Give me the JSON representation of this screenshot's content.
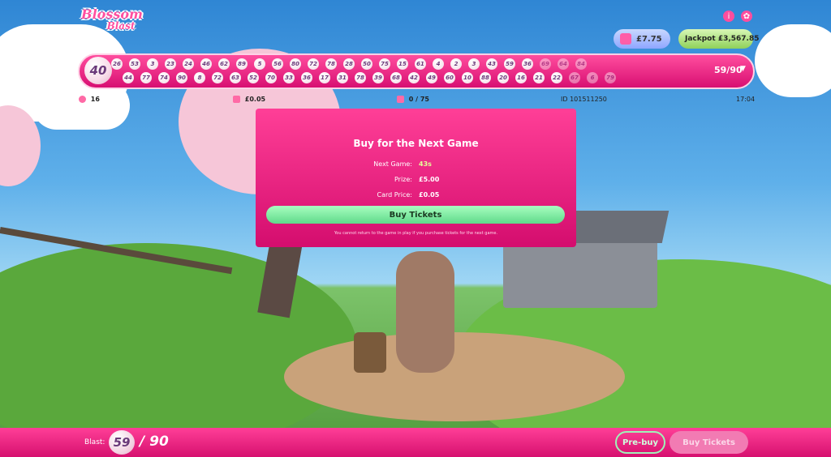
{
  "logo": {
    "line1": "Blossom",
    "line2": "Blast"
  },
  "header": {
    "info_icon": "info-icon",
    "settings_icon": "gear-icon",
    "balance": "£7.75",
    "jackpot_label": "Jackpot",
    "jackpot_value": "£3,567.85"
  },
  "ball_bar": {
    "current_ball": "40",
    "row1": [
      "26",
      "53",
      "3",
      "23",
      "24",
      "46",
      "62",
      "89",
      "5",
      "56",
      "80",
      "72",
      "78",
      "28",
      "50",
      "75",
      "15",
      "61",
      "4",
      "2",
      "3",
      "43",
      "59",
      "36",
      "69",
      "64",
      "84"
    ],
    "row2": [
      "44",
      "77",
      "74",
      "90",
      "8",
      "72",
      "63",
      "52",
      "70",
      "33",
      "36",
      "17",
      "31",
      "78",
      "39",
      "68",
      "42",
      "49",
      "60",
      "10",
      "88",
      "20",
      "16",
      "21",
      "22",
      "67",
      "6",
      "79"
    ],
    "count": "59/90"
  },
  "info_row": {
    "players": "16",
    "card_price": "£0.05",
    "cards": "0 / 75",
    "game_id": "ID 101511250",
    "time": "17:04"
  },
  "modal": {
    "title": "Buy for the Next Game",
    "next_game_label": "Next Game:",
    "next_game_value": "43s",
    "prize_label": "Prize:",
    "prize_value": "£5.00",
    "card_price_label": "Card Price:",
    "card_price_value": "£0.05",
    "buy_button": "Buy Tickets",
    "note": "You cannot return to the game in play if you purchase tickets for the next game."
  },
  "bottom": {
    "blast_label": "Blast:",
    "blast_value": "59",
    "blast_total": "/ 90",
    "prebuy": "Pre-buy",
    "buy": "Buy Tickets"
  }
}
